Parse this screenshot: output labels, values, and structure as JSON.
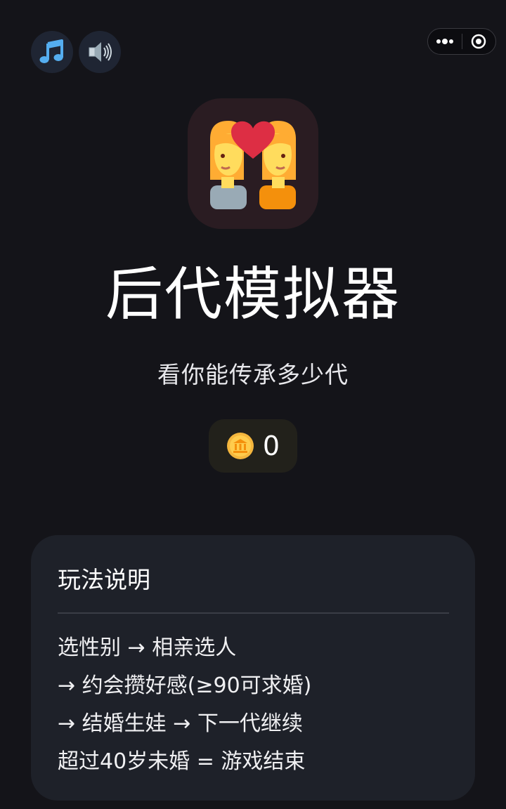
{
  "audio_controls": {
    "music_icon": "music-note-icon",
    "volume_icon": "speaker-icon"
  },
  "capsule": {
    "more_icon": "more-dots-icon",
    "close_icon": "target-close-icon"
  },
  "app": {
    "icon": "couple-with-heart-icon",
    "title": "后代模拟器",
    "subtitle": "看你能传承多少代"
  },
  "coins": {
    "icon": "coin-icon",
    "value": "0"
  },
  "rules": {
    "title": "玩法说明",
    "lines": [
      "选性别 → 相亲选人",
      "→ 约会攒好感(≥90可求婚)",
      "→ 结婚生娃 → 下一代继续",
      "超过40岁未婚 = 游戏结束"
    ]
  },
  "colors": {
    "background": "#141419",
    "card": "#1e2129",
    "accent_blue": "#55aef0",
    "heart": "#dd2e44",
    "coin": "#f4b63d"
  }
}
